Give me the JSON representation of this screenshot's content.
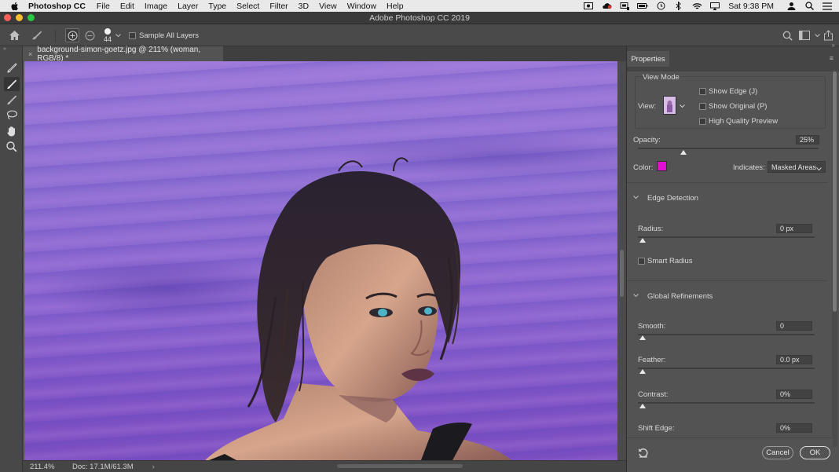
{
  "menubar": {
    "app_name": "Photoshop CC",
    "items": [
      "File",
      "Edit",
      "Image",
      "Layer",
      "Type",
      "Select",
      "Filter",
      "3D",
      "View",
      "Window",
      "Help"
    ],
    "clock": "Sat 9:38 PM"
  },
  "window": {
    "title": "Adobe Photoshop CC 2019",
    "traffic_colors": [
      "#fc5f57",
      "#fdbc2e",
      "#28c840"
    ]
  },
  "options": {
    "brush_size": "44",
    "sample_all_layers_label": "Sample All Layers",
    "sample_all_layers_checked": false
  },
  "document": {
    "tab_label": "background-simon-goetz.jpg @ 211% (woman, RGB/8) *",
    "overlay_color": "#8a64cf"
  },
  "status": {
    "zoom": "211.4%",
    "doc_size": "Doc: 17.1M/61.3M",
    "arrow": "›"
  },
  "properties": {
    "tab_label": "Properties",
    "view_mode": {
      "heading": "View Mode",
      "view_label": "View:",
      "show_edge_label": "Show Edge (J)",
      "show_original_label": "Show Original (P)",
      "high_quality_label": "High Quality Preview"
    },
    "opacity": {
      "label": "Opacity:",
      "value": "25%",
      "level": 0.25
    },
    "color": {
      "label": "Color:",
      "swatch": "#e10fd3"
    },
    "indicates": {
      "label": "Indicates:",
      "value": "Masked Areas"
    },
    "edge_detection": {
      "heading": "Edge Detection",
      "radius_label": "Radius:",
      "radius_value": "0 px",
      "smart_radius_label": "Smart Radius"
    },
    "global_refinements": {
      "heading": "Global Refinements",
      "smooth_label": "Smooth:",
      "smooth_value": "0",
      "feather_label": "Feather:",
      "feather_value": "0.0 px",
      "contrast_label": "Contrast:",
      "contrast_value": "0%",
      "shift_edge_label": "Shift Edge:",
      "shift_edge_value": "0%"
    },
    "cancel_label": "Cancel",
    "ok_label": "OK"
  }
}
